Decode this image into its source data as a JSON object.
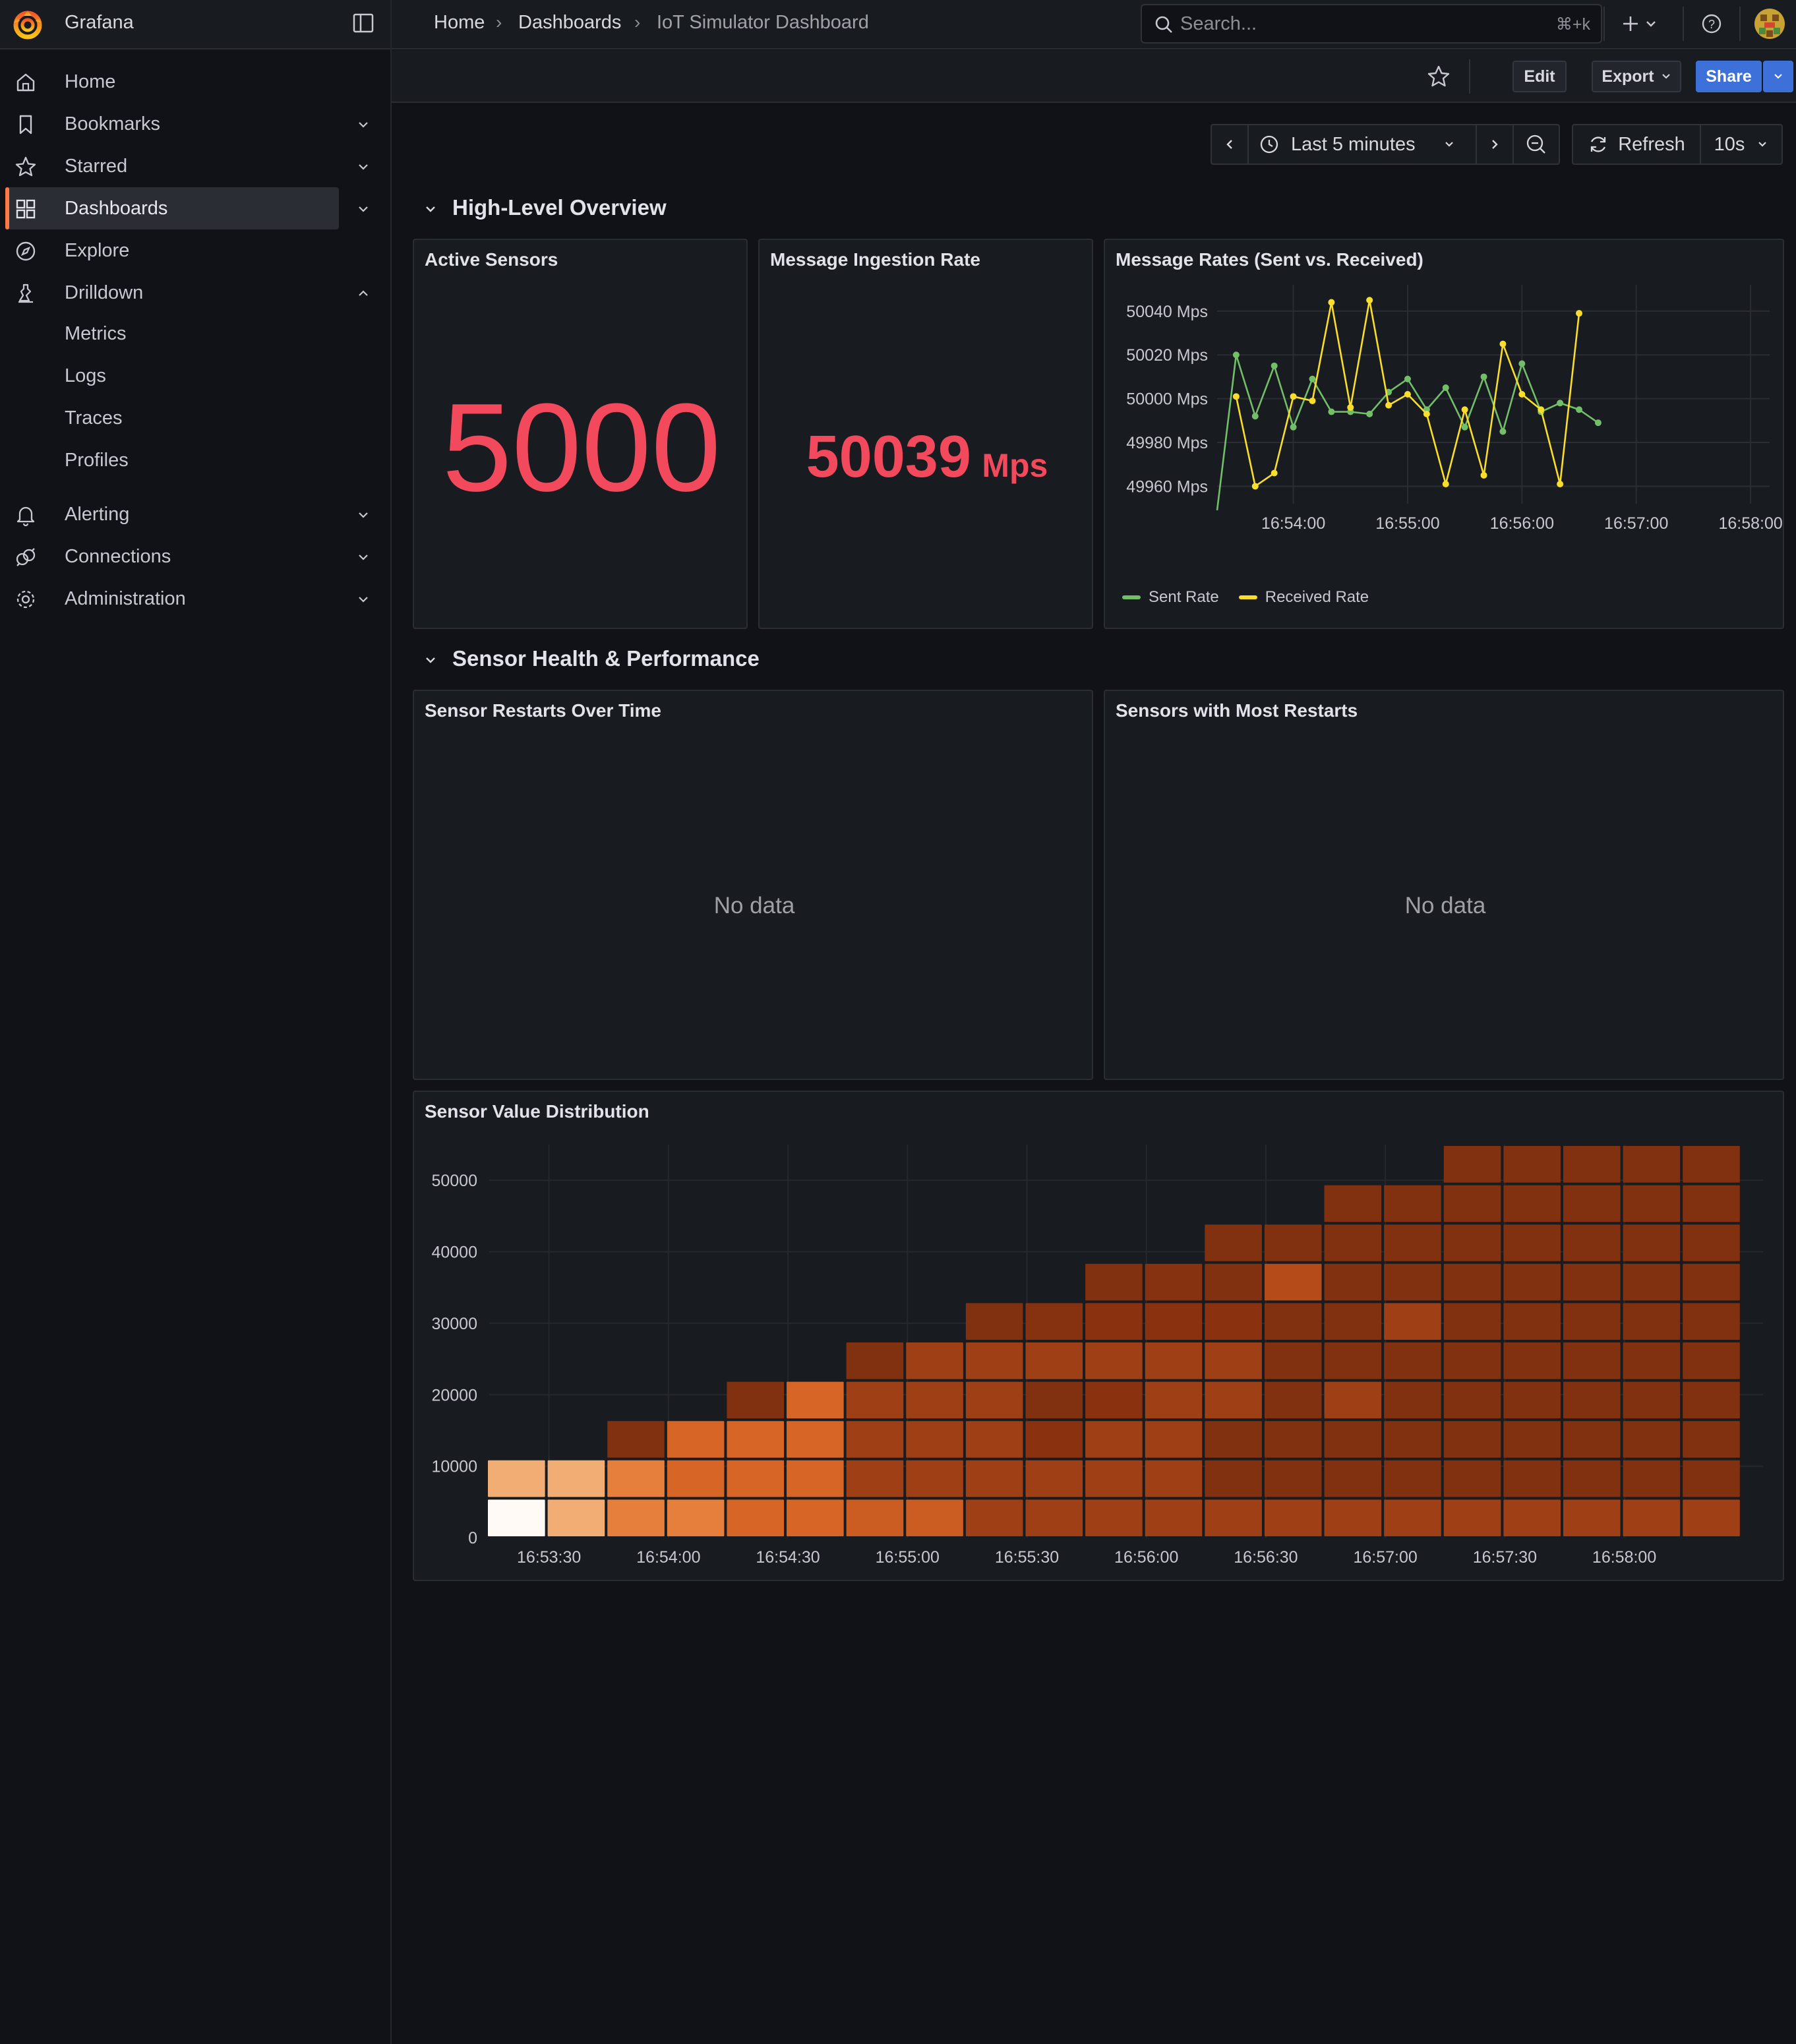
{
  "app": {
    "name": "Grafana"
  },
  "breadcrumbs": [
    "Home",
    "Dashboards",
    "IoT Simulator Dashboard"
  ],
  "search": {
    "placeholder": "Search...",
    "shortcut": "⌘+k"
  },
  "toolbar": {
    "edit": "Edit",
    "export": "Export",
    "share": "Share"
  },
  "sidebar": {
    "items": [
      {
        "label": "Home",
        "icon": "home-icon",
        "caret": false
      },
      {
        "label": "Bookmarks",
        "icon": "bookmark-icon",
        "caret": "down"
      },
      {
        "label": "Starred",
        "icon": "star-icon",
        "caret": "down"
      },
      {
        "label": "Dashboards",
        "icon": "apps-icon",
        "caret": "down",
        "active": true
      },
      {
        "label": "Explore",
        "icon": "compass-icon",
        "caret": false
      },
      {
        "label": "Drilldown",
        "icon": "drilldown-icon",
        "caret": "up"
      },
      {
        "label": "Alerting",
        "icon": "bell-icon",
        "caret": "down"
      },
      {
        "label": "Connections",
        "icon": "plug-icon",
        "caret": "down"
      },
      {
        "label": "Administration",
        "icon": "cog-icon",
        "caret": "down"
      }
    ],
    "drilldown_children": [
      "Metrics",
      "Logs",
      "Traces",
      "Profiles"
    ]
  },
  "time": {
    "range": "Last 5 minutes",
    "refresh": "Refresh",
    "interval": "10s"
  },
  "rows": [
    {
      "title": "High-Level Overview"
    },
    {
      "title": "Sensor Health & Performance"
    }
  ],
  "panels": {
    "active_sensors": {
      "title": "Active Sensors",
      "value": "5000"
    },
    "ingestion": {
      "title": "Message Ingestion Rate",
      "value": "50039",
      "unit": "Mps"
    },
    "rates": {
      "title": "Message Rates (Sent vs. Received)"
    },
    "restarts_time": {
      "title": "Sensor Restarts Over Time",
      "empty": "No data"
    },
    "restarts_top": {
      "title": "Sensors with Most Restarts",
      "empty": "No data"
    },
    "distribution": {
      "title": "Sensor Value Distribution"
    }
  },
  "colors": {
    "accent": "#ff7a45",
    "stat_red": "#f2495c",
    "sent": "#73bf69",
    "received": "#fade2a",
    "share_blue": "#3d71d9"
  },
  "chart_data": [
    {
      "type": "line",
      "title": "Message Rates (Sent vs. Received)",
      "x": [
        "16:53:20",
        "16:53:30",
        "16:53:40",
        "16:53:50",
        "16:54:00",
        "16:54:10",
        "16:54:20",
        "16:54:30",
        "16:54:40",
        "16:54:50",
        "16:55:00",
        "16:55:10",
        "16:55:20",
        "16:55:30",
        "16:55:40",
        "16:55:50",
        "16:56:00",
        "16:56:10",
        "16:56:20",
        "16:56:30",
        "16:56:40",
        "16:56:50",
        "16:57:00",
        "16:57:10",
        "16:57:20",
        "16:57:30",
        "16:57:40",
        "16:57:50",
        "16:58:00",
        "16:58:10"
      ],
      "x_ticks": [
        "16:54:00",
        "16:55:00",
        "16:56:00",
        "16:57:00",
        "16:58:00"
      ],
      "y_ticks": [
        "50040 Mps",
        "50020 Mps",
        "50000 Mps",
        "49980 Mps",
        "49960 Mps"
      ],
      "ylim": [
        49952,
        50052
      ],
      "series": [
        {
          "name": "Sent Rate",
          "color": "#73bf69",
          "values": [
            49949,
            50020,
            49992,
            50015,
            49987,
            50009,
            49994,
            49994,
            49993,
            50003,
            50009,
            49995,
            50005,
            49987,
            50010,
            49985,
            50016,
            49994,
            49998,
            49995,
            49989
          ]
        },
        {
          "name": "Received Rate",
          "color": "#fade2a",
          "values": [
            50001,
            49960,
            49966,
            50001,
            49999,
            50044,
            49996,
            50045,
            49997,
            50002,
            49993,
            49961,
            49995,
            49965,
            50025,
            50002,
            49995,
            49961,
            50039
          ]
        }
      ],
      "sent_x_index": [
        0,
        1,
        2,
        3,
        4,
        5,
        6,
        7,
        8,
        9,
        10,
        11,
        12,
        13,
        14,
        15,
        16,
        17,
        18,
        19,
        20
      ],
      "received_x_index": [
        1,
        2,
        3,
        4,
        5,
        6,
        7,
        8,
        9,
        10,
        11,
        12,
        13,
        14,
        15,
        16,
        17,
        18,
        19
      ],
      "legend": [
        "Sent Rate",
        "Received Rate"
      ]
    },
    {
      "type": "heatmap",
      "title": "Sensor Value Distribution",
      "x_ticks": [
        "16:53:30",
        "16:54:00",
        "16:54:30",
        "16:55:00",
        "16:55:30",
        "16:56:00",
        "16:56:30",
        "16:57:00",
        "16:57:30",
        "16:58:00"
      ],
      "y_ticks": [
        "0",
        "10000",
        "20000",
        "30000",
        "40000",
        "50000"
      ],
      "ylim": [
        0,
        55000
      ],
      "bucket_size": 5500,
      "columns": [
        [
          1.0,
          0.6
        ],
        [
          0.6,
          0.6
        ],
        [
          0.45,
          0.45,
          0.05
        ],
        [
          0.45,
          0.35,
          0.35
        ],
        [
          0.35,
          0.35,
          0.35,
          0.05
        ],
        [
          0.35,
          0.35,
          0.35,
          0.35
        ],
        [
          0.3,
          0.15,
          0.15,
          0.15,
          0.05
        ],
        [
          0.3,
          0.15,
          0.15,
          0.15,
          0.15
        ],
        [
          0.15,
          0.15,
          0.15,
          0.15,
          0.15,
          0.05
        ],
        [
          0.15,
          0.15,
          0.1,
          0.05,
          0.15,
          0.08
        ],
        [
          0.15,
          0.15,
          0.15,
          0.1,
          0.15,
          0.1,
          0.05
        ],
        [
          0.15,
          0.15,
          0.15,
          0.15,
          0.15,
          0.1,
          0.08
        ],
        [
          0.15,
          0.05,
          0.05,
          0.15,
          0.15,
          0.1,
          0.05,
          0.05
        ],
        [
          0.15,
          0.05,
          0.05,
          0.05,
          0.05,
          0.05,
          0.2,
          0.05
        ],
        [
          0.15,
          0.05,
          0.05,
          0.15,
          0.05,
          0.05,
          0.05,
          0.05,
          0.05
        ],
        [
          0.15,
          0.05,
          0.05,
          0.05,
          0.05,
          0.15,
          0.05,
          0.05,
          0.05
        ],
        [
          0.15,
          0.05,
          0.05,
          0.05,
          0.05,
          0.05,
          0.05,
          0.05,
          0.05,
          0.05
        ],
        [
          0.15,
          0.05,
          0.05,
          0.05,
          0.05,
          0.05,
          0.05,
          0.05,
          0.05,
          0.05
        ],
        [
          0.15,
          0.05,
          0.05,
          0.05,
          0.05,
          0.05,
          0.05,
          0.05,
          0.05,
          0.05
        ],
        [
          0.15,
          0.05,
          0.05,
          0.05,
          0.05,
          0.05,
          0.05,
          0.05,
          0.05,
          0.05
        ],
        [
          0.15,
          0.05,
          0.05,
          0.05,
          0.05,
          0.05,
          0.05,
          0.05,
          0.05,
          0.05
        ]
      ]
    }
  ]
}
